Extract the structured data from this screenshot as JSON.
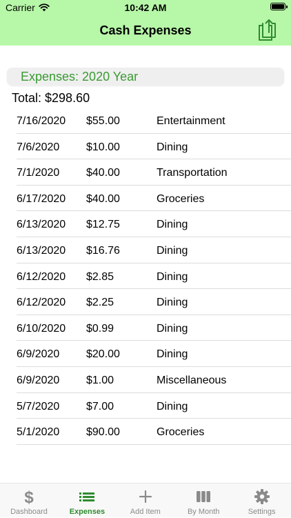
{
  "status_bar": {
    "carrier": "Carrier",
    "time": "10:42 AM"
  },
  "nav": {
    "title": "Cash Expenses",
    "share_icon": "share-icon"
  },
  "section": {
    "title": "Expenses: 2020 Year"
  },
  "total": "Total: $298.60",
  "expenses": [
    {
      "date": "7/16/2020",
      "amount": "$55.00",
      "category": "Entertainment"
    },
    {
      "date": "7/6/2020",
      "amount": "$10.00",
      "category": "Dining"
    },
    {
      "date": "7/1/2020",
      "amount": "$40.00",
      "category": "Transportation"
    },
    {
      "date": "6/17/2020",
      "amount": "$40.00",
      "category": "Groceries"
    },
    {
      "date": "6/13/2020",
      "amount": "$12.75",
      "category": "Dining"
    },
    {
      "date": "6/13/2020",
      "amount": "$16.76",
      "category": "Dining"
    },
    {
      "date": "6/12/2020",
      "amount": "$2.85",
      "category": "Dining"
    },
    {
      "date": "6/12/2020",
      "amount": "$2.25",
      "category": "Dining"
    },
    {
      "date": "6/10/2020",
      "amount": "$0.99",
      "category": "Dining"
    },
    {
      "date": "6/9/2020",
      "amount": "$20.00",
      "category": "Dining"
    },
    {
      "date": "6/9/2020",
      "amount": "$1.00",
      "category": "Miscellaneous"
    },
    {
      "date": "5/7/2020",
      "amount": "$7.00",
      "category": "Dining"
    },
    {
      "date": "5/1/2020",
      "amount": "$90.00",
      "category": "Groceries"
    }
  ],
  "tabs": [
    {
      "label": "Dashboard",
      "icon": "dollar-icon",
      "active": false
    },
    {
      "label": "Expenses",
      "icon": "list-icon",
      "active": true
    },
    {
      "label": "Add Item",
      "icon": "plus-icon",
      "active": false
    },
    {
      "label": "By Month",
      "icon": "columns-icon",
      "active": false
    },
    {
      "label": "Settings",
      "icon": "gear-icon",
      "active": false
    }
  ],
  "colors": {
    "nav_background": "#b7f7a8",
    "accent_green": "#2e8b2e",
    "section_title": "#3a9a32",
    "tab_inactive": "#8a8a8a"
  }
}
